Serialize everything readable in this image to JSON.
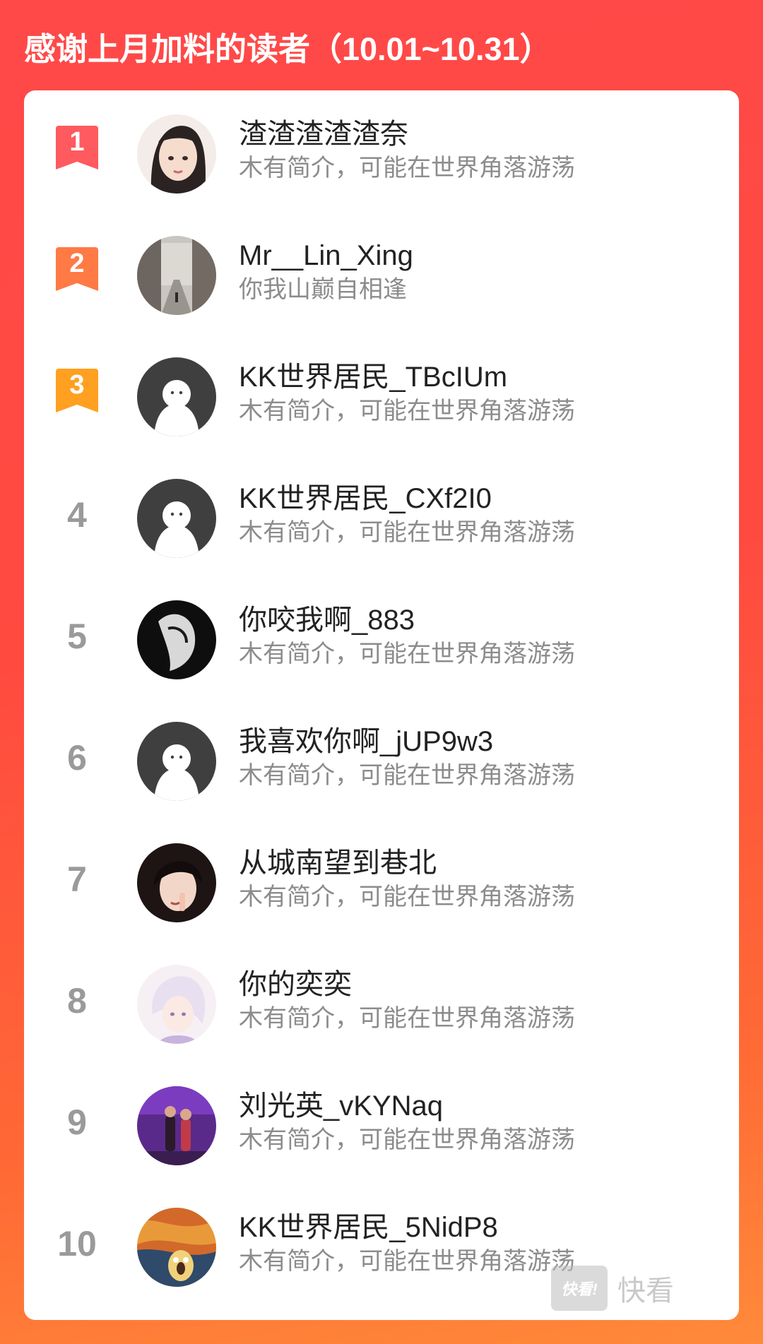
{
  "header": {
    "title": "感谢上月加料的读者（10.01~10.31）"
  },
  "colors": {
    "background": "#ff4a40",
    "rank1": "#ff5a5f",
    "rank2": "#ff7a45",
    "rank3": "#ffa020",
    "rank_plain": "#9a9a9a"
  },
  "readers": [
    {
      "rank": "1",
      "name": "渣渣渣渣渣奈",
      "bio": "木有简介，可能在世界角落游荡",
      "avatar": "avatar-illustrated-girl"
    },
    {
      "rank": "2",
      "name": "Mr__Lin_Xing",
      "bio": "你我山巅自相逢",
      "avatar": "avatar-city-street-photo"
    },
    {
      "rank": "3",
      "name": "KK世界居民_TBcIUm",
      "bio": "木有简介，可能在世界角落游荡",
      "avatar": "avatar-default-ghost"
    },
    {
      "rank": "4",
      "name": "KK世界居民_CXf2I0",
      "bio": "木有简介，可能在世界角落游荡",
      "avatar": "avatar-default-ghost"
    },
    {
      "rank": "5",
      "name": "你咬我啊_883",
      "bio": "木有简介，可能在世界角落游荡",
      "avatar": "avatar-dark-portrait"
    },
    {
      "rank": "6",
      "name": "我喜欢你啊_jUP9w3",
      "bio": "木有简介，可能在世界角落游荡",
      "avatar": "avatar-default-ghost"
    },
    {
      "rank": "7",
      "name": "从城南望到巷北",
      "bio": "木有简介，可能在世界角落游荡",
      "avatar": "avatar-anime-boy"
    },
    {
      "rank": "8",
      "name": "你的奕奕",
      "bio": "木有简介，可能在世界角落游荡",
      "avatar": "avatar-anime-pastel"
    },
    {
      "rank": "9",
      "name": "刘光英_vKYNaq",
      "bio": "木有简介，可能在世界角落游荡",
      "avatar": "avatar-purple-photo"
    },
    {
      "rank": "10",
      "name": "KK世界居民_5NidP8",
      "bio": "木有简介，可能在世界角落游荡",
      "avatar": "avatar-scream-art"
    }
  ],
  "watermark": {
    "logo": "快看!",
    "text": "快看"
  }
}
